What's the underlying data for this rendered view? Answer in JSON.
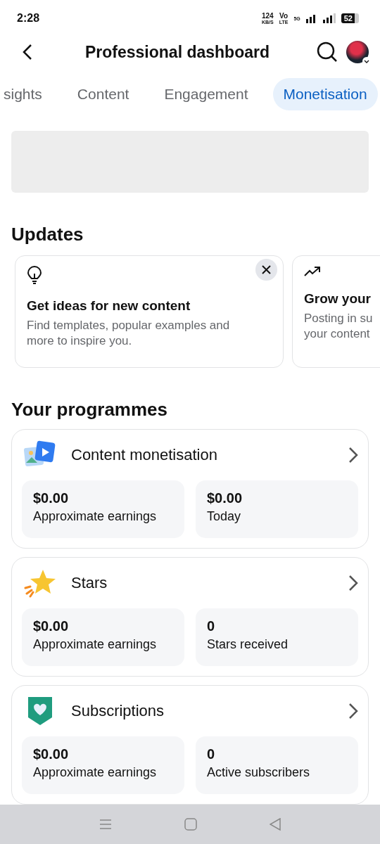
{
  "status_bar": {
    "time": "2:28",
    "speed": "124",
    "speed_unit": "KB/S",
    "volte_top": "Vo",
    "volte_bottom": "LTE",
    "network": "5G",
    "battery": "52"
  },
  "header": {
    "title": "Professional dashboard"
  },
  "tabs": [
    {
      "label": "sights",
      "selected": false
    },
    {
      "label": "Content",
      "selected": false
    },
    {
      "label": "Engagement",
      "selected": false
    },
    {
      "label": "Monetisation",
      "selected": true
    }
  ],
  "updates": {
    "heading": "Updates",
    "cards": [
      {
        "kind": "idea",
        "title": "Get ideas for new content",
        "body": "Find templates, popular examples and more to inspire you."
      },
      {
        "kind": "growth",
        "title": "Grow your",
        "body_lines": [
          "Posting in su",
          "your content"
        ]
      }
    ]
  },
  "programmes": {
    "heading": "Your programmes",
    "items": [
      {
        "kind": "content",
        "title": "Content monetisation",
        "stats": [
          {
            "value": "$0.00",
            "label": "Approximate earnings"
          },
          {
            "value": "$0.00",
            "label": "Today"
          }
        ]
      },
      {
        "kind": "stars",
        "title": "Stars",
        "stats": [
          {
            "value": "$0.00",
            "label": "Approximate earnings"
          },
          {
            "value": "0",
            "label": "Stars received"
          }
        ]
      },
      {
        "kind": "subscriptions",
        "title": "Subscriptions",
        "stats": [
          {
            "value": "$0.00",
            "label": "Approximate earnings"
          },
          {
            "value": "0",
            "label": "Active subscribers"
          }
        ]
      }
    ]
  }
}
